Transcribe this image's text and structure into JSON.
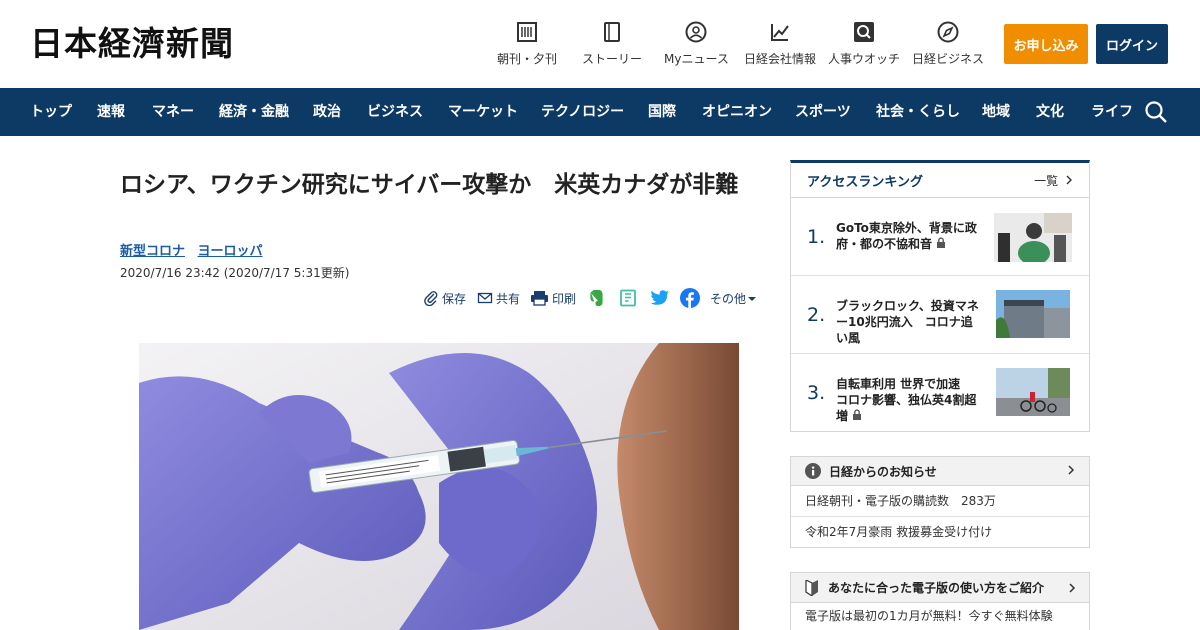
{
  "header": {
    "logo_text": "日本経濟新聞",
    "utilities": [
      {
        "label": "朝刊・夕刊",
        "icon": "newspaper-icon"
      },
      {
        "label": "ストーリー",
        "icon": "book-icon"
      },
      {
        "label": "Myニュース",
        "icon": "user-icon"
      },
      {
        "label": "日経会社情報",
        "icon": "chart-icon"
      },
      {
        "label": "人事ウオッチ",
        "icon": "search-person-icon"
      },
      {
        "label": "日経ビジネス",
        "icon": "compass-icon"
      }
    ],
    "apply_label": "お申し込み",
    "login_label": "ログイン"
  },
  "nav": {
    "items": [
      "トップ",
      "速報",
      "マネー",
      "経済・金融",
      "政治",
      "ビジネス",
      "マーケット",
      "テクノロジー",
      "国際",
      "オピニオン",
      "スポーツ",
      "社会・くらし",
      "地域",
      "文化",
      "ライフ"
    ]
  },
  "article": {
    "title": "ロシア、ワクチン研究にサイバー攻撃か　米英カナダが非難",
    "topics": [
      "新型コロナ",
      "ヨーロッパ"
    ],
    "date": "2020/7/16 23:42 (2020/7/17 5:31更新)",
    "share": {
      "save": "保存",
      "share": "共有",
      "print": "印刷",
      "other": "その他"
    }
  },
  "ranking": {
    "heading": "アクセスランキング",
    "more": "一覧",
    "items": [
      {
        "num": "1.",
        "text": "GoTo東京除外、背景に政府・都の不協和音"
      },
      {
        "num": "2.",
        "text": "ブラックロック、投資マネー10兆円流入　コロナ追い風"
      },
      {
        "num": "3.",
        "text": "自転車利用 世界で加速　コロナ影響、独仏英4割超増"
      }
    ]
  },
  "notices": {
    "heading": "日経からのお知らせ",
    "rows": [
      "日経朝刊・電子版の購読数　283万",
      "令和2年7月豪雨 救援募金受け付け"
    ]
  },
  "guide": {
    "heading": "あなたに合った電子版の使い方をご紹介",
    "row": "電子版は最初の1カ月が無料！今すぐ無料体験"
  },
  "colors": {
    "nav_bg": "#0d3a64",
    "apply_bg": "#f08e00",
    "link": "#1a5ca8"
  }
}
